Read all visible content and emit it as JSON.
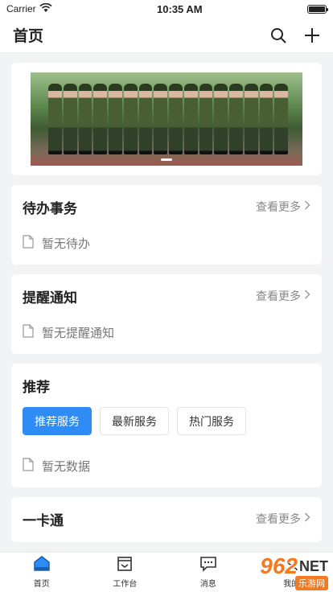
{
  "status_bar": {
    "carrier": "Carrier",
    "time": "10:35 AM",
    "battery_level": 1.0
  },
  "nav": {
    "title": "首页",
    "icons": [
      "search-icon",
      "plus-icon"
    ]
  },
  "banner": {
    "slides": 1,
    "active_slide": 0
  },
  "todo": {
    "title": "待办事务",
    "more": "查看更多",
    "empty": "暂无待办"
  },
  "reminder": {
    "title": "提醒通知",
    "more": "查看更多",
    "empty": "暂无提醒通知"
  },
  "recommend": {
    "title": "推荐",
    "tabs": [
      {
        "label": "推荐服务",
        "active": true
      },
      {
        "label": "最新服务",
        "active": false
      },
      {
        "label": "热门服务",
        "active": false
      }
    ],
    "empty": "暂无数据"
  },
  "card": {
    "title": "一卡通",
    "more": "查看更多"
  },
  "tab_bar": {
    "items": [
      {
        "label": "首页",
        "icon": "home-icon"
      },
      {
        "label": "工作台",
        "icon": "workbench-icon"
      },
      {
        "label": "消息",
        "icon": "message-icon"
      },
      {
        "label": "我的",
        "icon": "profile-icon"
      }
    ]
  },
  "watermark": {
    "number": "962",
    "suffix": "NET",
    "sub": "乐游网"
  },
  "colors": {
    "accent": "#2f8cf5",
    "background": "#f2f3f5",
    "watermark": "#f57a1f"
  }
}
